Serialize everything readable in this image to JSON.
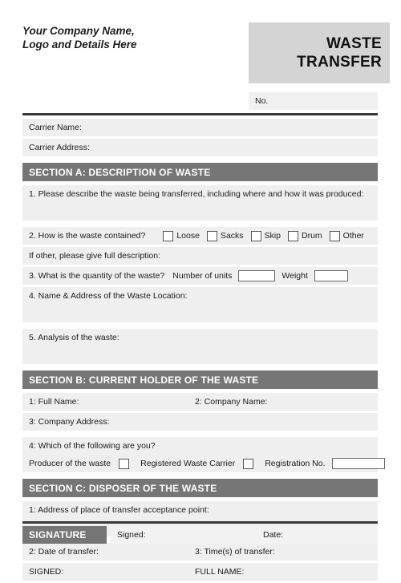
{
  "header": {
    "company_line1": "Your Company Name,",
    "company_line2": "Logo and Details Here",
    "title_line1": "WASTE",
    "title_line2": "TRANSFER",
    "number_label": "No."
  },
  "carrier": {
    "name_label": "Carrier Name:",
    "address_label": "Carrier Address:"
  },
  "section_a": {
    "heading": "SECTION A: DESCRIPTION OF WASTE",
    "q1_label": "1. Please describe the waste being transferred, including where and how it was produced:",
    "q2_label": "2. How is the waste contained?",
    "q2_options": [
      "Loose",
      "Sacks",
      "Skip",
      "Drum",
      "Other"
    ],
    "q2_other_label": "If other, please give full description:",
    "q3_label": "3. What is the quantity of the waste?",
    "q3_units_label": "Number of units",
    "q3_units_value": "",
    "q3_weight_label": "Weight",
    "q3_weight_value": "",
    "q4_label": "4. Name & Address of the Waste Location:",
    "q5_label": "5. Analysis of the waste:"
  },
  "section_b": {
    "heading": "SECTION B: CURRENT HOLDER OF THE WASTE",
    "q1_label": "1: Full Name:",
    "q2_label": "2: Company Name:",
    "q3_label": "3: Company Address:",
    "q4_label": "4: Which of the following are you?",
    "producer_label": "Producer of the waste",
    "carrier_label": "Registered Waste Carrier",
    "regno_label": "Registration No.",
    "regno_value": ""
  },
  "section_c": {
    "heading": "SECTION C: DISPOSER OF THE WASTE",
    "q1_label": "1: Address of place of transfer acceptance point:",
    "q2_label": "2: Date of transfer:",
    "q3_label": "3: Time(s) of transfer:",
    "signed_label": "SIGNED:",
    "fullname_label": "FULL NAME:"
  },
  "signature": {
    "badge_label": "SIGNATURE",
    "signed_label": "Signed:",
    "date_label": "Date:"
  },
  "colors": {
    "section_bar": "#767676",
    "title_box": "#d4d4d4",
    "row_fill": "#efefef",
    "rule": "#3a3a3a"
  }
}
